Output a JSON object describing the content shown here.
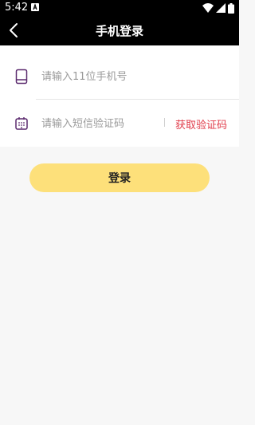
{
  "status_bar": {
    "time": "5:42"
  },
  "header": {
    "title": "手机登录"
  },
  "form": {
    "phone": {
      "placeholder": "请输入11位手机号"
    },
    "sms": {
      "placeholder": "请输入短信验证码",
      "get_code_label": "获取验证码"
    }
  },
  "login_button": {
    "label": "登录"
  },
  "colors": {
    "accent": "#fde07a",
    "link": "#e03a48",
    "icon": "#5b2a6e",
    "header_bg": "#000000"
  }
}
